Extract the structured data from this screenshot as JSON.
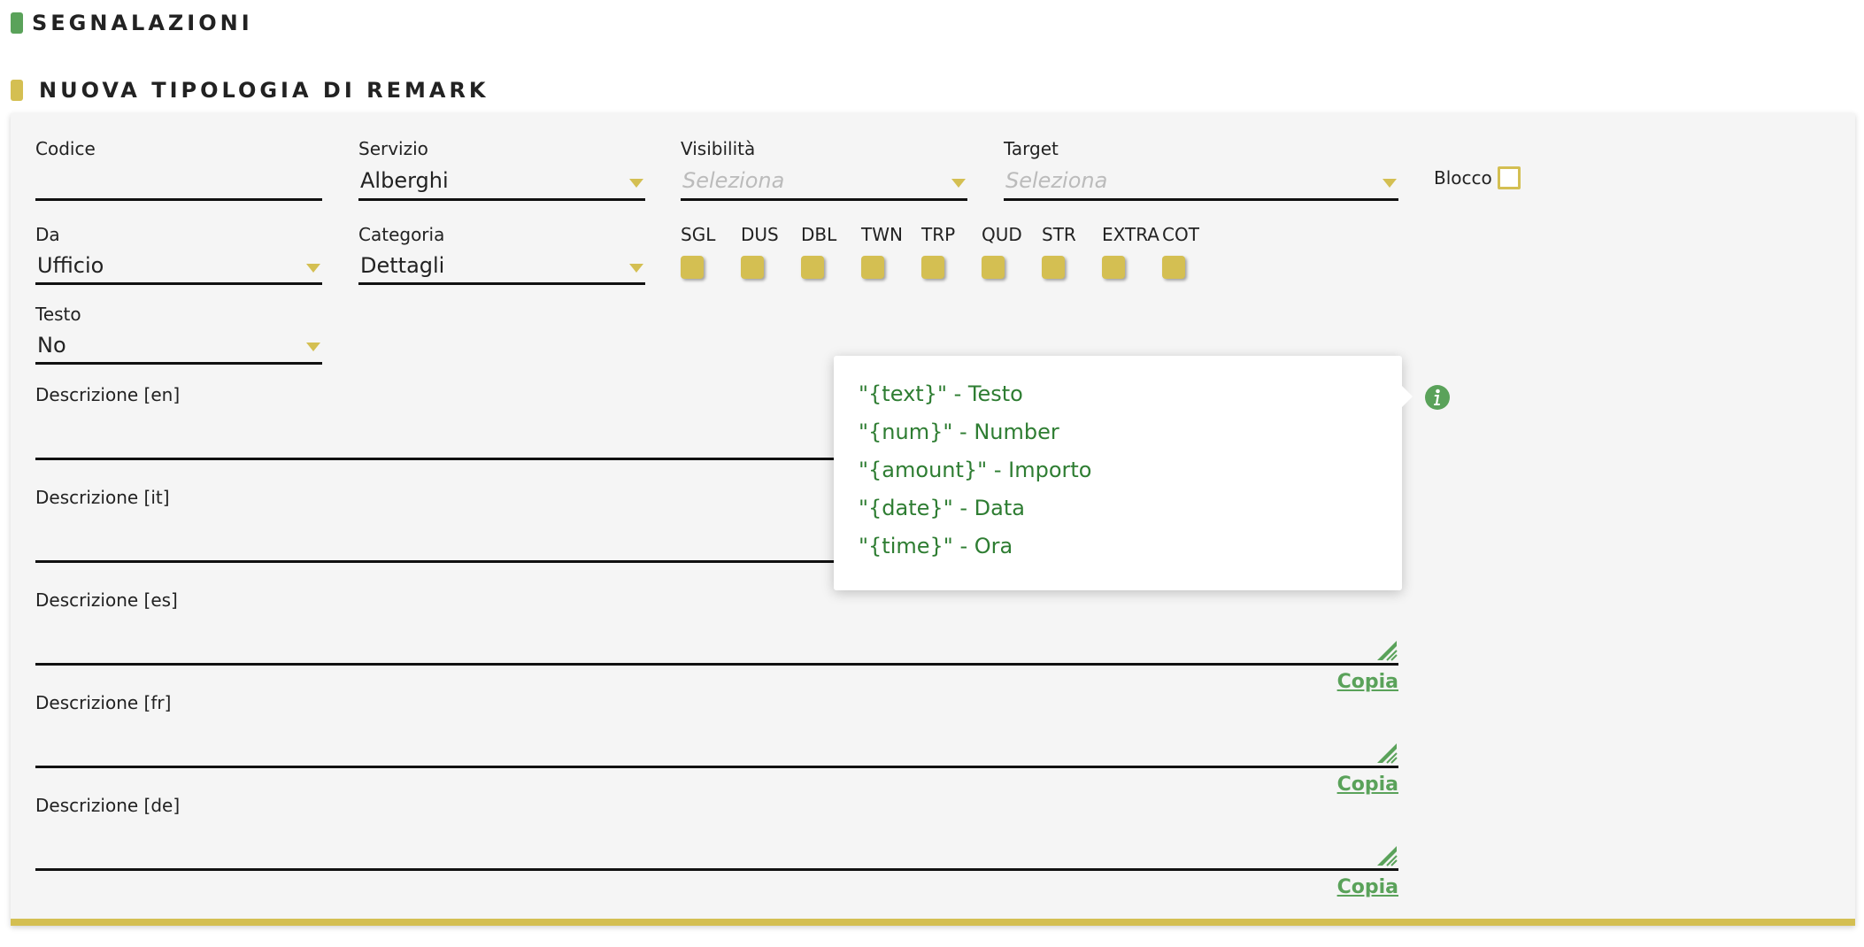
{
  "sections": {
    "segnalazioni": "SEGNALAZIONI",
    "nuova_tipologia": "NUOVA TIPOLOGIA DI REMARK"
  },
  "form": {
    "codice": {
      "label": "Codice",
      "value": ""
    },
    "servizio": {
      "label": "Servizio",
      "value": "Alberghi"
    },
    "visibilita": {
      "label": "Visibilità",
      "placeholder": "Seleziona"
    },
    "target": {
      "label": "Target",
      "placeholder": "Seleziona"
    },
    "blocco": {
      "label": "Blocco",
      "checked": false
    },
    "da": {
      "label": "Da",
      "value": "Ufficio"
    },
    "categoria": {
      "label": "Categoria",
      "value": "Dettagli"
    },
    "testo": {
      "label": "Testo",
      "value": "No"
    },
    "room_types": [
      "SGL",
      "DUS",
      "DBL",
      "TWN",
      "TRP",
      "QUD",
      "STR",
      "EXTRA",
      "COT"
    ],
    "descriptions": [
      {
        "label": "Descrizione [en]"
      },
      {
        "label": "Descrizione [it]"
      },
      {
        "label": "Descrizione [es]",
        "copy_label": "Copia"
      },
      {
        "label": "Descrizione [fr]",
        "copy_label": "Copia"
      },
      {
        "label": "Descrizione [de]",
        "copy_label": "Copia"
      }
    ]
  },
  "placeholders_popup": {
    "items": [
      "\"{text}\" - Testo",
      "\"{num}\" - Number",
      "\"{amount}\" - Importo",
      "\"{date}\" - Data",
      "\"{time}\" - Ora"
    ]
  },
  "colors": {
    "accent_gold": "#d4bf52",
    "accent_green": "#5aa25a",
    "popup_text_green": "#2e7d32",
    "panel_bg": "#f5f5f5"
  },
  "icons": {
    "info": "info-icon",
    "resize": "resize-handle-icon",
    "dropdown": "caret-down-icon"
  }
}
